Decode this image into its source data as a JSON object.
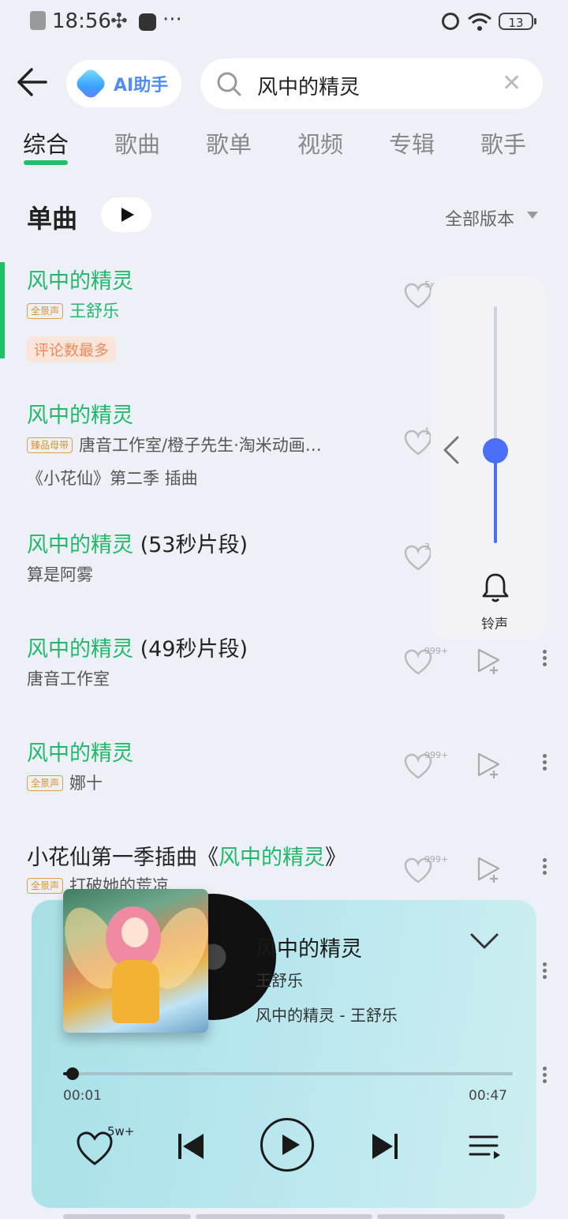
{
  "status_bar": {
    "time": "18:56",
    "battery": "13"
  },
  "header": {
    "ai_label": "AI助手",
    "search_value": "风中的精灵"
  },
  "tabs": [
    {
      "label": "综合"
    },
    {
      "label": "歌曲"
    },
    {
      "label": "歌单"
    },
    {
      "label": "视频"
    },
    {
      "label": "专辑"
    },
    {
      "label": "歌手"
    }
  ],
  "section": {
    "title": "单曲",
    "version_filter": "全部版本"
  },
  "songs": [
    {
      "title": "风中的精灵",
      "title_suffix": "",
      "badge": "全景声",
      "artist": "王舒乐",
      "extra": "评论数最多",
      "count": "5w"
    },
    {
      "title": "风中的精灵",
      "title_suffix": "",
      "badge": "臻品母带",
      "artist": "唐音工作室/橙子先生·淘米动画…",
      "extra": "《小花仙》第二季 插曲",
      "count": "1"
    },
    {
      "title": "风中的精灵",
      "title_suffix": " (53秒片段)",
      "badge": "",
      "artist": "算是阿雾",
      "extra": "",
      "count": "3"
    },
    {
      "title": "风中的精灵",
      "title_suffix": " (49秒片段)",
      "badge": "",
      "artist": "唐音工作室",
      "extra": "",
      "count": "999+"
    },
    {
      "title": "风中的精灵",
      "title_suffix": "",
      "badge": "全景声",
      "artist": "娜十",
      "extra": "",
      "count": "999+"
    },
    {
      "title_prefix": "小花仙第一季插曲《",
      "title": "风中的精灵",
      "title_suffix": "》",
      "badge": "全景声",
      "artist": "打破她的荒凉",
      "extra": "",
      "count": "999+"
    }
  ],
  "ringtone_panel": {
    "label": "铃声",
    "level": 0.39
  },
  "player": {
    "title": "风中的精灵",
    "artist": "王舒乐",
    "lyric": "风中的精灵 - 王舒乐",
    "current_time": "00:01",
    "total_time": "00:47",
    "progress": 0.021,
    "like_count": "5w+"
  },
  "colors": {
    "accent_green": "#20c06a",
    "slider_blue": "#4a6ef5",
    "badge_orange": "#d8932c"
  }
}
